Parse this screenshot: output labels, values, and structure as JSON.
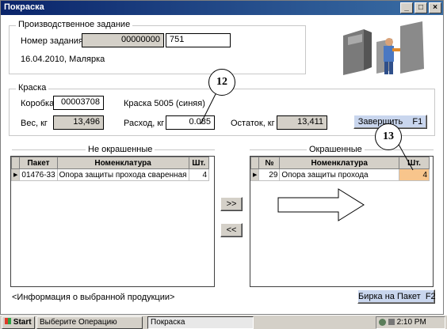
{
  "window": {
    "title": "Покраска",
    "min": "_",
    "max": "□",
    "close": "×"
  },
  "task": {
    "group_title": "Производственное задание",
    "number_label": "Номер задания",
    "number_code": "00000000",
    "number_value": "751",
    "date_line": "16.04.2010, Малярка"
  },
  "paint": {
    "group_title": "Краска",
    "box_label": "Коробка",
    "box_value": "00003708",
    "paint_name": "Краска 5005 (синяя)",
    "weight_label": "Вес, кг",
    "weight_value": "13,496",
    "usage_label": "Расход, кг",
    "usage_value": "0.085",
    "rest_label": "Остаток, кг",
    "rest_value": "13,411",
    "finish_button": "Завершить    F1"
  },
  "unpainted": {
    "title": "Не окрашенные",
    "headers": [
      "Пакет",
      "Номенклатура",
      "Шт."
    ],
    "rows": [
      {
        "packet": "01476-33",
        "name": "Опора защиты прохода сваренная",
        "qty": "4"
      }
    ]
  },
  "painted": {
    "title": "Окрашенные",
    "headers": [
      "№",
      "Номенклатура",
      "Шт."
    ],
    "rows": [
      {
        "num": "29",
        "name": "Опора защиты прохода",
        "qty": "4"
      }
    ]
  },
  "move_buttons": {
    "forward": ">>",
    "back": "<<"
  },
  "info_text": "<Информация о выбранной продукции>",
  "tag_button": "Бирка на Пакет  F2",
  "callouts": {
    "a": "12",
    "b": "13"
  },
  "taskbar": {
    "start": "Start",
    "item1": "Выберите Операцию",
    "item2": "Покраска",
    "clock": "2:10 PM"
  }
}
